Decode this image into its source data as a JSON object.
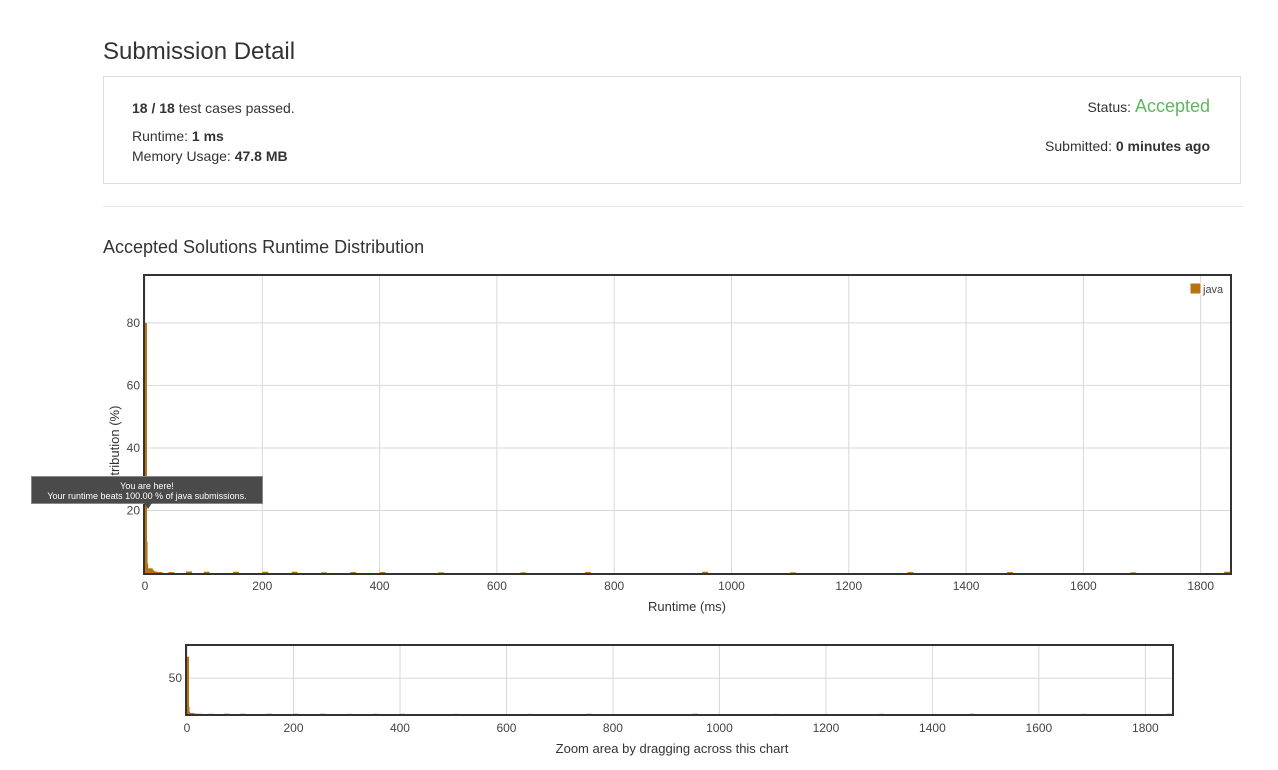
{
  "page": {
    "title": "Submission Detail"
  },
  "summary": {
    "cases_passed": "18 / 18",
    "cases_suffix": "test cases passed.",
    "runtime_label": "Runtime:",
    "runtime_value": "1 ms",
    "memory_label": "Memory Usage:",
    "memory_value": "47.8 MB",
    "status_label": "Status:",
    "status_value": "Accepted",
    "submitted_label": "Submitted:",
    "submitted_value": "0 minutes ago",
    "status_color": "#5cb85c"
  },
  "distribution": {
    "title": "Accepted Solutions Runtime Distribution",
    "tooltip_line1": "You are here!",
    "tooltip_line2": "Your runtime beats 100.00 % of java submissions.",
    "navigator_label": "Zoom area by dragging across this chart"
  },
  "chart_data": [
    {
      "type": "bar",
      "xlabel": "Runtime (ms)",
      "ylabel": "Distribution (%)",
      "xlim": [
        0,
        1850
      ],
      "ylim": [
        0,
        95
      ],
      "xticks": [
        0,
        200,
        400,
        600,
        800,
        1000,
        1200,
        1400,
        1600,
        1800
      ],
      "yticks": [
        20,
        40,
        60,
        80
      ],
      "grid": true,
      "legend_position": "top-right",
      "series": [
        {
          "name": "java",
          "color": "#b8720f",
          "x": [
            0,
            1,
            2,
            3,
            5,
            8,
            12,
            20,
            40,
            70,
            100,
            150,
            200,
            250,
            300,
            350,
            400,
            500,
            640,
            750,
            950,
            1100,
            1300,
            1470,
            1680,
            1840
          ],
          "values": [
            80,
            10,
            3,
            1.5,
            1,
            0.6,
            0.4,
            0.3,
            0.3,
            0.5,
            0.4,
            0.4,
            0.4,
            0.4,
            0.2,
            0.3,
            0.3,
            0.2,
            0.2,
            0.3,
            0.4,
            0.2,
            0.3,
            0.3,
            0.2,
            0.4
          ]
        }
      ]
    },
    {
      "type": "area",
      "xlabel": "Zoom area by dragging across this chart",
      "xlim": [
        0,
        1850
      ],
      "xticks": [
        0,
        200,
        400,
        600,
        800,
        1000,
        1200,
        1400,
        1600,
        1800
      ],
      "yticks": [
        50
      ],
      "grid": true,
      "series": [
        {
          "color": "#b8720f",
          "x": [
            0,
            1,
            2,
            3,
            5,
            8,
            12,
            20,
            40,
            70,
            100,
            150,
            200,
            250,
            300,
            350,
            400,
            500,
            640,
            750,
            950,
            1100,
            1300,
            1470,
            1680,
            1840
          ],
          "values": [
            80,
            10,
            3,
            1.5,
            1,
            0.6,
            0.4,
            0.3,
            0.3,
            0.5,
            0.4,
            0.4,
            0.4,
            0.4,
            0.2,
            0.3,
            0.3,
            0.2,
            0.2,
            0.3,
            0.4,
            0.2,
            0.3,
            0.3,
            0.2,
            0.4
          ]
        }
      ]
    }
  ]
}
